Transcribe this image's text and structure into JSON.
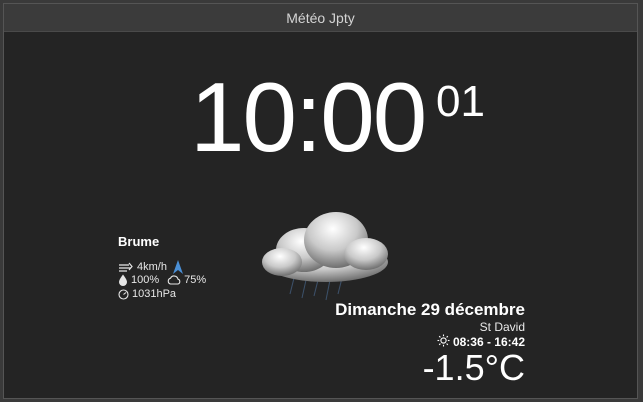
{
  "window": {
    "title": "Météo Jpty"
  },
  "clock": {
    "hours_minutes": "10:00",
    "seconds": "01"
  },
  "weather": {
    "condition": "Brume",
    "wind": "4km/h",
    "humidity": "100%",
    "cloud_cover": "75%",
    "pressure": "1031hPa",
    "icon": "cloud-with-rain-icon"
  },
  "date": {
    "label": "Dimanche 29 décembre",
    "saint": "St David",
    "sun_times": "08:36 - 16:42"
  },
  "temperature": "-1.5°C",
  "colors": {
    "background": "#242424",
    "titlebar": "#3b3b3b",
    "text": "#ffffff",
    "wind_arrow": "#4a8fd6"
  }
}
